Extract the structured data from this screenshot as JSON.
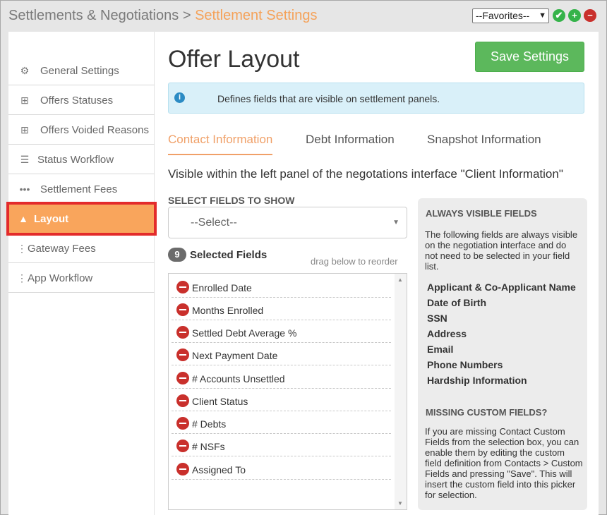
{
  "header": {
    "breadcrumb_parent": "Settlements & Negotiations",
    "breadcrumb_separator": ">",
    "breadcrumb_current": "Settlement Settings",
    "favorites_value": "--Favorites--",
    "add_favorite_symbol": "✔",
    "add_symbol": "+",
    "remove_symbol": "−"
  },
  "sidebar": {
    "items": [
      {
        "label": "General Settings",
        "icon": "gears-icon"
      },
      {
        "label": "Offers Statuses",
        "icon": "sitemap-icon"
      },
      {
        "label": "Offers Voided Reasons",
        "icon": "sitemap-icon"
      },
      {
        "label": "Status Workflow",
        "icon": "list-icon"
      },
      {
        "label": "Settlement Fees",
        "icon": "ellipsis-icon"
      },
      {
        "label": "Layout",
        "icon": "shapes-icon",
        "active": true
      },
      {
        "label": "Gateway Fees",
        "icon": "vertical-ellipsis-icon"
      },
      {
        "label": "App Workflow",
        "icon": "vertical-ellipsis-icon"
      }
    ]
  },
  "main": {
    "title": "Offer Layout",
    "save_label": "Save Settings",
    "info_text": "Defines fields that are visible on settlement panels.",
    "tabs": [
      {
        "label": "Contact Information",
        "active": true
      },
      {
        "label": "Debt Information"
      },
      {
        "label": "Snapshot Information"
      }
    ],
    "section_description": "Visible within the left panel of the negotations interface \"Client Information\"",
    "select_label": "SELECT FIELDS TO SHOW",
    "select_placeholder": "--Select--",
    "selected_count": "9",
    "selected_title": "Selected Fields",
    "drag_hint": "drag below to reorder",
    "selected_fields": [
      "Enrolled Date",
      "Months Enrolled",
      "Settled Debt Average %",
      "Next Payment Date",
      "# Accounts Unsettled",
      "Client Status",
      "# Debts",
      "# NSFs",
      "Assigned To"
    ]
  },
  "always_visible": {
    "title": "ALWAYS VISIBLE FIELDS",
    "description": "The following fields are always visible on the negotiation interface and do not need to be selected in your field list.",
    "fields": [
      "Applicant & Co-Applicant Name",
      "Date of Birth",
      "SSN",
      "Address",
      "Email",
      "Phone Numbers",
      "Hardship Information"
    ],
    "missing_title": "MISSING CUSTOM FIELDS?",
    "missing_description": "If you are missing Contact Custom Fields from the selection box, you can enable them by editing the custom field definition from Contacts > Custom Fields and pressing \"Save\". This will insert the custom field into this picker for selection."
  },
  "colors": {
    "accent_orange": "#f9a55c",
    "highlight_red": "#e32b2b",
    "save_green": "#5cb85c",
    "remove_red": "#c9302c"
  }
}
